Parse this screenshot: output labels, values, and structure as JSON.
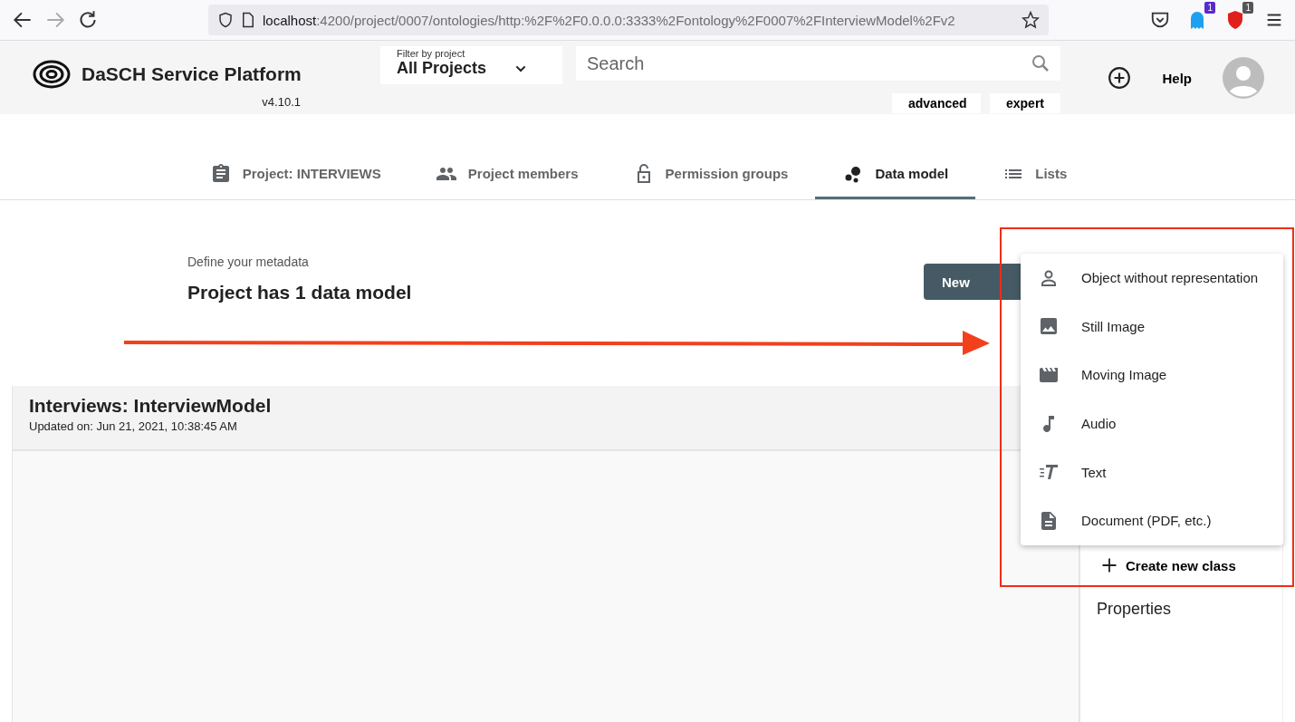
{
  "browser": {
    "url_host": "localhost",
    "url_path": ":4200/project/0007/ontologies/http:%2F%2F0.0.0.0:3333%2Fontology%2F0007%2FInterviewModel%2Fv2",
    "extension_badges": [
      "1",
      "1"
    ]
  },
  "header": {
    "app_name": "DaSCH Service Platform",
    "version": "v4.10.1",
    "filter_label": "Filter by project",
    "filter_value": "All Projects",
    "search": {
      "placeholder": "Search"
    },
    "search_modes": [
      "advanced",
      "expert"
    ],
    "help": "Help"
  },
  "tabs": [
    {
      "label": "Project: INTERVIEWS",
      "kind": "project",
      "selected": false
    },
    {
      "label": "Project members",
      "kind": "members",
      "selected": false
    },
    {
      "label": "Permission groups",
      "kind": "permissions",
      "selected": false
    },
    {
      "label": "Data model",
      "kind": "datamodel",
      "selected": true
    },
    {
      "label": "Lists",
      "kind": "lists",
      "selected": false
    }
  ],
  "intro": {
    "subtitle": "Define your metadata",
    "title": "Project has 1 data model",
    "button": "New"
  },
  "data_model": {
    "title": "Interviews: InterviewModel",
    "updated": "Updated on: Jun 21, 2021, 10:38:45 AM"
  },
  "side_panel": {
    "create_class": "Create new class",
    "properties": "Properties"
  },
  "class_menu": [
    {
      "label": "Object without representation",
      "kind": "person"
    },
    {
      "label": "Still Image",
      "kind": "image"
    },
    {
      "label": "Moving Image",
      "kind": "movie"
    },
    {
      "label": "Audio",
      "kind": "audio"
    },
    {
      "label": "Text",
      "kind": "text"
    },
    {
      "label": "Document (PDF, etc.)",
      "kind": "document"
    }
  ]
}
